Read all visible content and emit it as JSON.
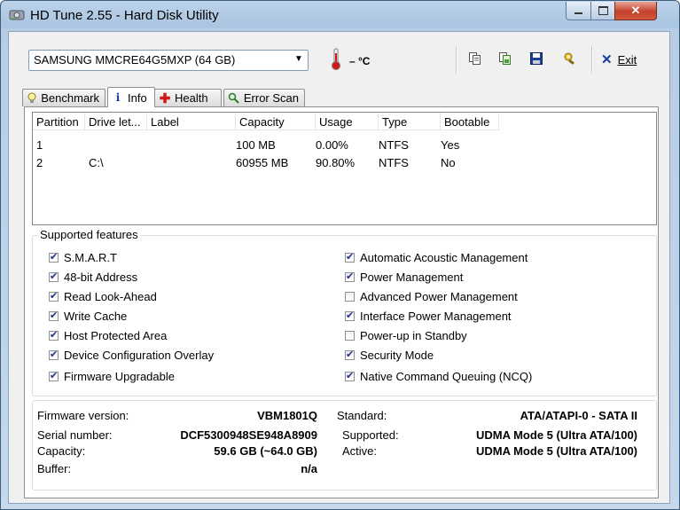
{
  "window": {
    "title": "HD Tune 2.55 - Hard Disk Utility"
  },
  "toolbar": {
    "drive": "SAMSUNG MMCRE64G5MXP (64 GB)",
    "temperature": "– °C",
    "exit_label": "Exit"
  },
  "tabs": [
    {
      "label": "Benchmark",
      "icon": "benchmark-icon"
    },
    {
      "label": "Info",
      "icon": "info-icon"
    },
    {
      "label": "Health",
      "icon": "health-icon"
    },
    {
      "label": "Error Scan",
      "icon": "search-icon"
    }
  ],
  "partitions": {
    "columns": [
      "Partition",
      "Drive let...",
      "Label",
      "Capacity",
      "Usage",
      "Type",
      "Bootable"
    ],
    "rows": [
      [
        "1",
        "",
        "",
        "100 MB",
        "0.00%",
        "NTFS",
        "Yes"
      ],
      [
        "2",
        "C:\\",
        "",
        "60955 MB",
        "90.80%",
        "NTFS",
        "No"
      ]
    ]
  },
  "features": {
    "title": "Supported features",
    "left": [
      {
        "label": "S.M.A.R.T",
        "checked": true
      },
      {
        "label": "48-bit Address",
        "checked": true
      },
      {
        "label": "Read Look-Ahead",
        "checked": true
      },
      {
        "label": "Write Cache",
        "checked": true
      },
      {
        "label": "Host Protected Area",
        "checked": true
      },
      {
        "label": "Device Configuration Overlay",
        "checked": true
      },
      {
        "label": "Firmware Upgradable",
        "checked": true
      }
    ],
    "right": [
      {
        "label": "Automatic Acoustic Management",
        "checked": true
      },
      {
        "label": "Power Management",
        "checked": true
      },
      {
        "label": "Advanced Power Management",
        "checked": false
      },
      {
        "label": "Interface Power Management",
        "checked": true
      },
      {
        "label": "Power-up in Standby",
        "checked": false
      },
      {
        "label": "Security Mode",
        "checked": true
      },
      {
        "label": "Native Command Queuing (NCQ)",
        "checked": true
      }
    ]
  },
  "details": {
    "firmware_label": "Firmware version:",
    "firmware": "VBM1801Q",
    "serial_label": "Serial number:",
    "serial": "DCF5300948SE948A8909",
    "capacity_label": "Capacity:",
    "capacity": "59.6 GB (~64.0 GB)",
    "buffer_label": "Buffer:",
    "buffer": "n/a",
    "standard_label": "Standard:",
    "standard": "ATA/ATAPI-0 - SATA II",
    "supported_label": "Supported:",
    "supported": "UDMA Mode 5 (Ultra ATA/100)",
    "active_label": "Active:",
    "active": "UDMA Mode 5 (Ultra ATA/100)"
  }
}
